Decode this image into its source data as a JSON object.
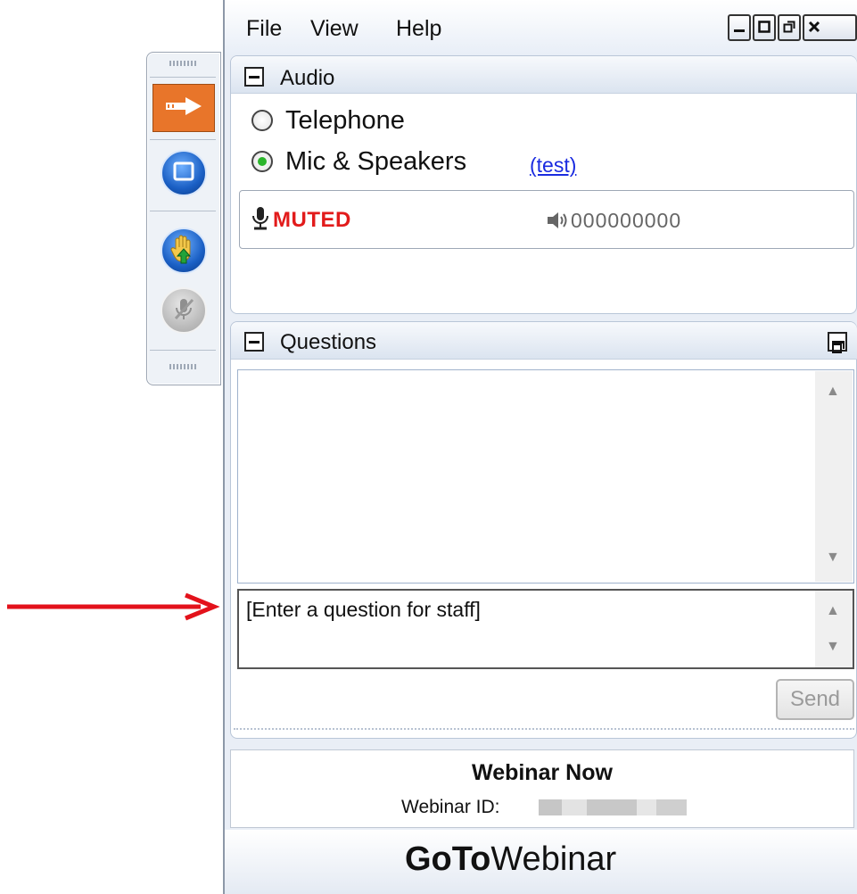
{
  "menu": {
    "file": "File",
    "view": "View",
    "help": "Help"
  },
  "window_buttons": [
    "minimize",
    "maximize",
    "restore",
    "close"
  ],
  "audio": {
    "title": "Audio",
    "options": [
      {
        "label": "Telephone",
        "selected": false
      },
      {
        "label": "Mic & Speakers",
        "selected": true
      }
    ],
    "test_link": "(test)",
    "mic_status": "MUTED",
    "speaker_level": "000000000"
  },
  "questions": {
    "title": "Questions",
    "input_placeholder": "[Enter a question for staff]",
    "send_label": "Send"
  },
  "webinar": {
    "name": "Webinar Now",
    "id_label": "Webinar ID:"
  },
  "brand": {
    "bold": "GoTo",
    "regular": "Webinar"
  },
  "icons": {
    "toolbar": [
      "show-hide-arrow-icon",
      "screen-icon",
      "raise-hand-icon",
      "mic-disabled-icon"
    ],
    "mic": "microphone-icon",
    "speaker": "speaker-icon"
  },
  "colors": {
    "muted": "#e21b1b",
    "link": "#1a2be0",
    "annotation_arrow": "#e3121b",
    "toolbar_accent": "#e8752a"
  }
}
